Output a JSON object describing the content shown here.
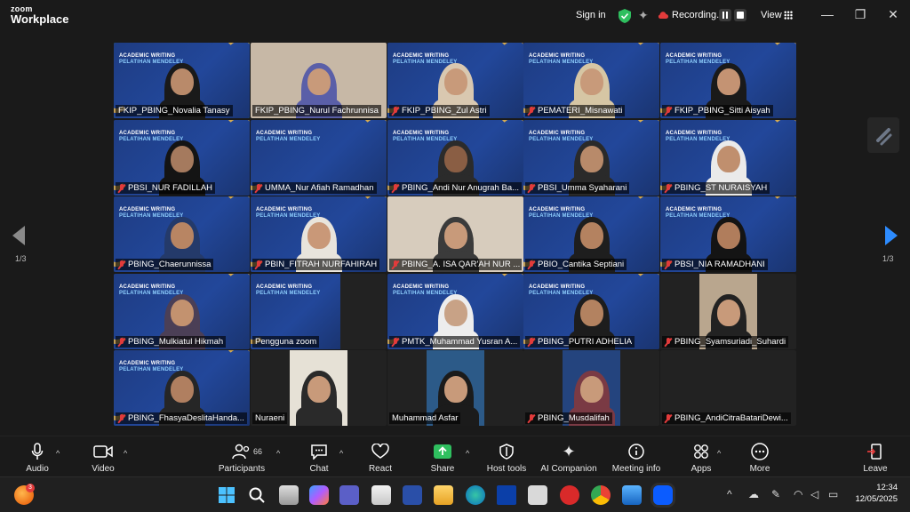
{
  "app": {
    "logo_line1": "zoom",
    "logo_line2": "Workplace",
    "signin": "Sign in",
    "recording": "Recording...",
    "view": "View"
  },
  "banner": {
    "line1": "ACADEMIC WRITING",
    "line2": "PELATIHAN MENDELEY"
  },
  "participants": [
    {
      "name": "FKIP_PBING_Novalia Tanasy",
      "muted": false,
      "active": true,
      "kind": "banner",
      "skin": "#b98a6a",
      "hijab": "#1a1a1a"
    },
    {
      "name": "FKIP_PBING_Nurul Fachrunnisa",
      "muted": false,
      "kind": "photo",
      "bg": "#c7b8a6",
      "hijab": "#5a5fa8"
    },
    {
      "name": "FKIP_PBING_Zul Astri",
      "muted": true,
      "kind": "banner",
      "skin": "#c89a7a",
      "hijab": "#d9c8b0"
    },
    {
      "name": "PEMATERI_Misnawati",
      "muted": true,
      "kind": "banner",
      "skin": "#c89a7a",
      "hijab": "#d6c6a4"
    },
    {
      "name": "FKIP_PBING_Sitti Aisyah",
      "muted": true,
      "kind": "banner",
      "skin": "#c49373",
      "hijab": "#1a1a1a"
    },
    {
      "name": "PBSI_NUR FADILLAH",
      "muted": true,
      "kind": "banner",
      "skin": "#a57a5e",
      "hijab": "#141414"
    },
    {
      "name": "UMMA_Nur Afiah Ramadhan",
      "muted": true,
      "kind": "banner-empty"
    },
    {
      "name": "PBING_Andi Nur Anugrah Ba...",
      "muted": true,
      "kind": "banner",
      "skin": "#8a5e44",
      "hijab": "#2b2b2b"
    },
    {
      "name": "PBSI_Umma Syaharani",
      "muted": true,
      "kind": "banner",
      "skin": "#b88a6a",
      "hijab": "#2a2a2a"
    },
    {
      "name": "PBING_ST NURAISYAH",
      "muted": true,
      "kind": "banner",
      "skin": "#c08f6e",
      "hijab": "#eaeaea"
    },
    {
      "name": "PBING_Chaerunnissa",
      "muted": true,
      "kind": "banner",
      "skin": "#b88563",
      "hijab": "#243a6a"
    },
    {
      "name": "PBIN_FITRAH NURFAHIRAH",
      "muted": true,
      "kind": "banner",
      "skin": "#c99878",
      "hijab": "#e8e4dc"
    },
    {
      "name": "PBING_A. ISA QAR'AH NUR ...",
      "muted": true,
      "kind": "photo",
      "bg": "#d7ccbd",
      "hijab": "#3b3b3b"
    },
    {
      "name": "PBIO_Cantika Septiani",
      "muted": true,
      "kind": "banner",
      "skin": "#b48260",
      "hijab": "#1e1e1e"
    },
    {
      "name": "PBSI_NIA RAMADHANI",
      "muted": true,
      "kind": "banner",
      "skin": "#b07d5c",
      "hijab": "#141414"
    },
    {
      "name": "PBING_Mulkiatul Hikmah",
      "muted": true,
      "kind": "banner",
      "skin": "#c3926f",
      "hijab": "#4b3f56"
    },
    {
      "name": "Pengguna zoom",
      "muted": false,
      "kind": "half-banner"
    },
    {
      "name": "PMTK_Muhammad Yusran A...",
      "muted": true,
      "kind": "banner",
      "skin": "#c8a286",
      "hijab": "#ededed"
    },
    {
      "name": "PBING_PUTRI ADHELIA",
      "muted": true,
      "kind": "banner",
      "skin": "#b38260",
      "hijab": "#1d1d1d"
    },
    {
      "name": "PBING_Syamsuriadi_Suhardi",
      "muted": true,
      "kind": "photo-small",
      "bg": "#b9a68e",
      "hijab": "#222222"
    },
    {
      "name": "PBING_FhasyaDeslitaHanda...",
      "muted": true,
      "kind": "banner",
      "skin": "#b07f60",
      "hijab": "#262626"
    },
    {
      "name": "Nuraeni",
      "muted": false,
      "kind": "photo-small",
      "bg": "#e6e1d6",
      "hijab": "#2a2a2a"
    },
    {
      "name": "Muhammad Asfar",
      "muted": false,
      "kind": "photo-small",
      "bg": "#2c5a88",
      "hijab": "#1b1b1b"
    },
    {
      "name": "PBING_Musdalifah",
      "muted": true,
      "kind": "photo-small",
      "bg": "#24447e",
      "hijab": "#7a3a44"
    },
    {
      "name": "PBING_AndiCitraBatariDewi...",
      "muted": true,
      "kind": "dark"
    }
  ],
  "nav": {
    "page_left": "1/3",
    "page_right": "1/3"
  },
  "toolbar": {
    "audio": "Audio",
    "video": "Video",
    "participants": "Participants",
    "participant_count": "66",
    "chat": "Chat",
    "react": "React",
    "share": "Share",
    "host_tools": "Host tools",
    "ai_companion": "AI Companion",
    "meeting_info": "Meeting info",
    "apps": "Apps",
    "more": "More",
    "leave": "Leave"
  },
  "taskbar": {
    "notification_badge": "3",
    "time": "12:34",
    "date": "12/05/2025"
  },
  "colors": {
    "active_speaker": "#2fd96b",
    "banner_blue": "#1f3a78",
    "banner_gold": "#e8b54a",
    "muted_red": "#e23b3b",
    "share_green": "#2fbf5f",
    "leave_red": "#e23b3b"
  }
}
